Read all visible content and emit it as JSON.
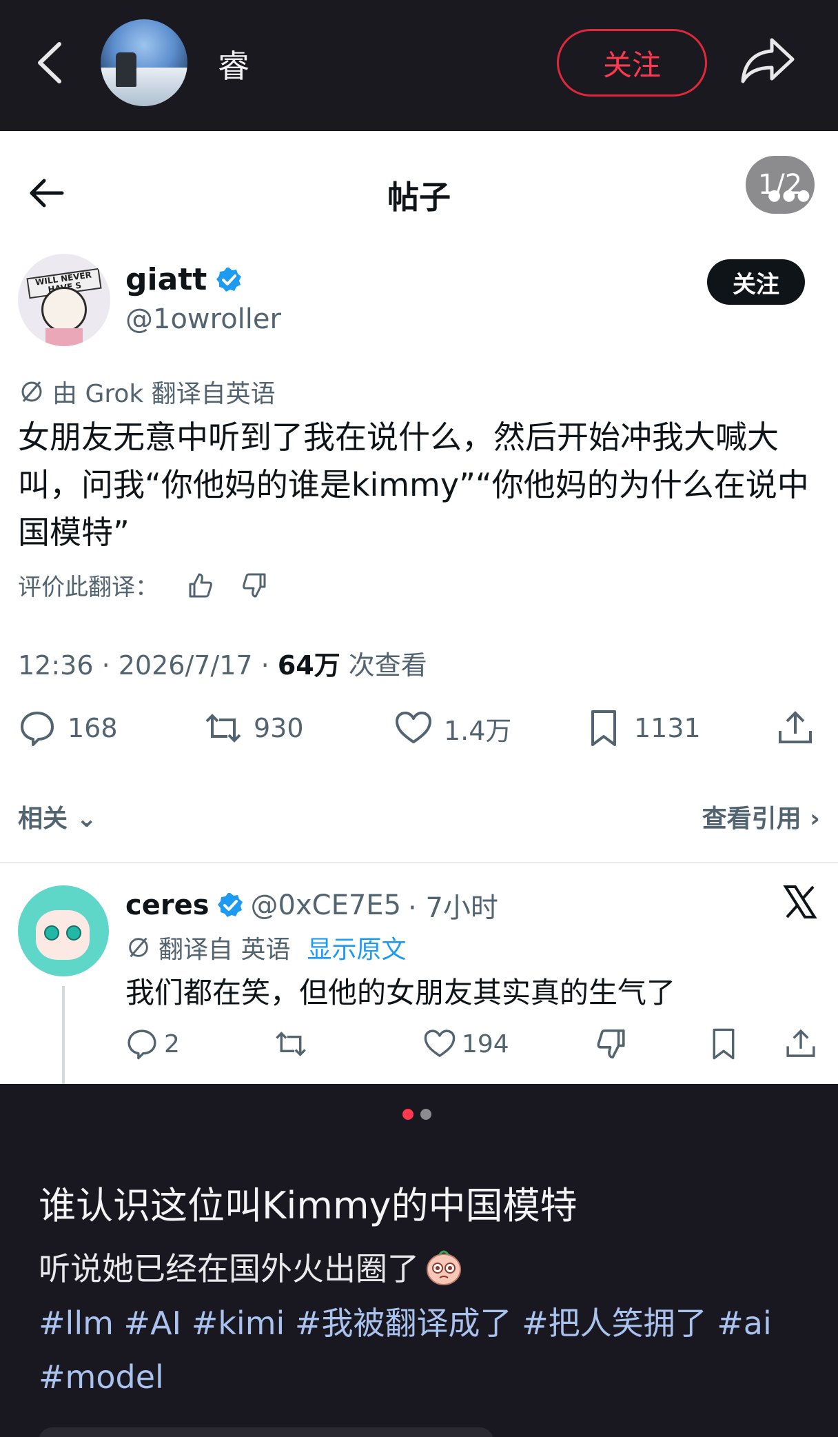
{
  "topbar": {
    "username": "睿",
    "follow_label": "关注"
  },
  "post": {
    "header_title": "帖子",
    "page_indicator": "1/2",
    "author": {
      "name": "giatt",
      "handle": "@1owroller",
      "follow_label": "关注",
      "avatar_band_text": "WILL NEVER HAVE S"
    },
    "translation_note": "由 Grok 翻译自英语",
    "text": "女朋友无意中听到了我在说什么，然后开始冲我大喊大叫，问我“你他妈的谁是kimmy”“你他妈的为什么在说中国模特”",
    "rate_label": "评价此翻译：",
    "time": "12:36 · 2026/7/17 · ",
    "views_count": "64万",
    "views_label": " 次查看",
    "replies": "168",
    "retweets": "930",
    "likes": "1.4万",
    "bookmarks": "1131",
    "related_label": "相关",
    "view_quotes_label": "查看引用"
  },
  "reply": {
    "name": "ceres",
    "handle": "@0xCE7E5",
    "time": "· 7小时",
    "translation_note": "翻译自 英语",
    "show_original": "显示原文",
    "text": "我们都在笑，但他的女朋友其实真的生气了",
    "replies": "2",
    "likes": "194"
  },
  "note": {
    "title": "谁认识这位叫Kimmy的中国模特",
    "body": "听说她已经在国外火出圈了",
    "tags": "#llm #AI #kimi #我被翻译成了 #把人笑拥了 #ai #model"
  },
  "colors": {
    "accent_red": "#ff3850",
    "verified_blue": "#1d9bf0",
    "dark_bg": "#191820"
  }
}
